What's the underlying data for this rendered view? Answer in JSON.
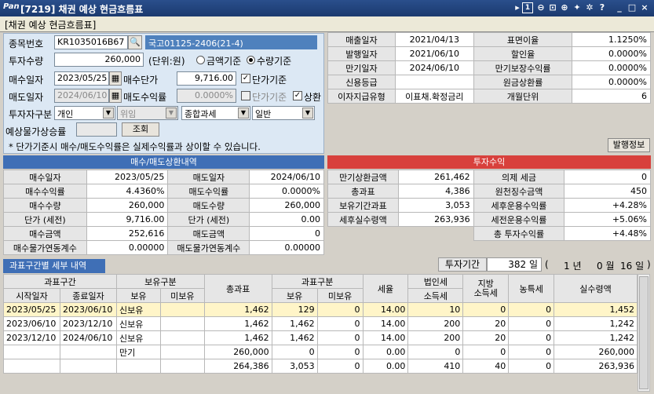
{
  "window": {
    "logo": "Pan",
    "title": "[7219] 채권 예상 현금흐름표",
    "icons": [
      "pin-icon",
      "page-icon",
      "zoom-out-icon",
      "fit-icon",
      "zoom-in-icon",
      "pushpin-icon",
      "star-icon",
      "help-icon",
      "minimize-icon",
      "maximize-icon",
      "close-icon"
    ],
    "page_num": "1"
  },
  "header": {
    "label": "[채권 예상 현금흐름표]"
  },
  "form": {
    "code_label": "종목번호",
    "code": "KR1035016B67",
    "bond_name": "국고01125-2406(21-4)",
    "qty_label": "투자수량",
    "qty": "260,000",
    "unit": "(단위:원)",
    "radio1": "금액기준",
    "radio2": "수량기준",
    "buy_date_label": "매수일자",
    "buy_date": "2023/05/25",
    "buy_price_label": "매수단가",
    "buy_price": "9,716.00",
    "unit_price_chk": "단가기준",
    "sell_date_label": "매도일자",
    "sell_date": "2024/06/10",
    "sell_yield_label": "매도수익률",
    "sell_yield": "0.0000%",
    "unit_price_chk2": "단가기준",
    "redeem_chk": "상환",
    "investor_label": "투자자구분",
    "investor": "개인",
    "deleg": "위임",
    "tax": "종합과세",
    "general": "일반",
    "exp_label": "예상물가상승률",
    "query": "조회",
    "note": "* 단가기준시 매수/매도수익률은 실제수익률과 상이할 수 있습니다."
  },
  "info": {
    "rows": [
      [
        "매출일자",
        "2021/04/13",
        "표면이율",
        "1.1250%"
      ],
      [
        "발행일자",
        "2021/06/10",
        "할인율",
        "0.0000%"
      ],
      [
        "만기일자",
        "2024/06/10",
        "만기보장수익률",
        "0.0000%"
      ],
      [
        "신용등급",
        "",
        "원금상환률",
        "0.0000%"
      ],
      [
        "이자지급유형",
        "이표채.확정금리",
        "개월단위",
        "6"
      ]
    ],
    "issue_btn": "발행정보"
  },
  "trade": {
    "header": "매수/매도상환내역",
    "rows": [
      [
        "매수일자",
        "2023/05/25",
        "매도일자",
        "2024/06/10"
      ],
      [
        "매수수익률",
        "4.4360%",
        "매도수익률",
        "0.0000%"
      ],
      [
        "매수수량",
        "260,000",
        "매도수량",
        "260,000"
      ],
      [
        "단가    (세전)",
        "9,716.00",
        "단가    (세전)",
        "0.00"
      ],
      [
        "매수금액",
        "252,616",
        "매도금액",
        "0"
      ],
      [
        "매수물가연동계수",
        "0.00000",
        "매도물가연동계수",
        "0.00000"
      ]
    ]
  },
  "invest": {
    "header": "투자수익",
    "rows": [
      [
        "만기상환금액",
        "261,462",
        "의제 세금",
        "0"
      ],
      [
        "총과표",
        "4,386",
        "원천징수금액",
        "450"
      ],
      [
        "보유기간과표",
        "3,053",
        "세후운용수익률",
        "+4.28%"
      ],
      [
        "세후실수령액",
        "263,936",
        "세전운용수익률",
        "+5.06%"
      ],
      [
        "",
        "",
        "총 투자수익률",
        "+4.48%"
      ]
    ]
  },
  "detail": {
    "tab": "과표구간별 세부 내역",
    "period_label": "투자기간",
    "period_days": "382 일",
    "paren_open": "(",
    "years": "1 년",
    "months": "0 월",
    "days": "16 일",
    "paren_close": ")",
    "head1": [
      "과표구간",
      "보유구분",
      "총과표",
      "과표구분",
      "세율",
      "법인세",
      "지방\n소득세",
      "농특세",
      "실수령액"
    ],
    "head2": [
      "시작일자",
      "종료일자",
      "보유",
      "미보유",
      "보유",
      "미보유",
      "소득세"
    ],
    "rows": [
      [
        "2023/05/25",
        "2023/06/10",
        "신보유",
        "",
        "1,462",
        "129",
        "0",
        "14.00",
        "10",
        "0",
        "0",
        "1,452"
      ],
      [
        "2023/06/10",
        "2023/12/10",
        "신보유",
        "",
        "1,462",
        "1,462",
        "0",
        "14.00",
        "200",
        "20",
        "0",
        "1,242"
      ],
      [
        "2023/12/10",
        "2024/06/10",
        "신보유",
        "",
        "1,462",
        "1,462",
        "0",
        "14.00",
        "200",
        "20",
        "0",
        "1,242"
      ],
      [
        "",
        "",
        "만기",
        "",
        "260,000",
        "0",
        "0",
        "0.00",
        "0",
        "0",
        "0",
        "260,000"
      ],
      [
        "",
        "",
        "",
        "",
        "264,386",
        "3,053",
        "0",
        "0.00",
        "410",
        "40",
        "0",
        "263,936"
      ]
    ]
  }
}
